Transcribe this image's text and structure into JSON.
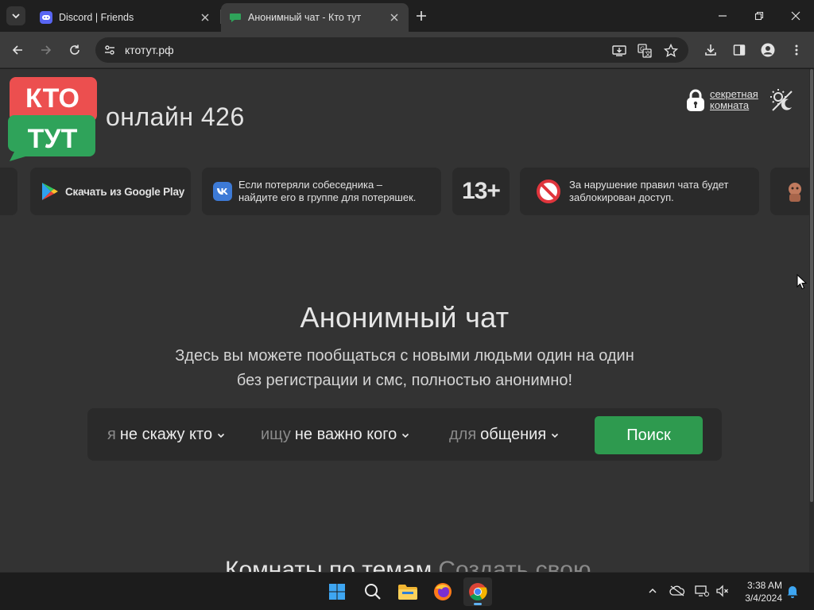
{
  "browser": {
    "tabs": [
      {
        "title": "Discord | Friends",
        "favicon": "discord-icon",
        "active": false
      },
      {
        "title": "Анонимный чат - Кто тут",
        "favicon": "chat-bubble-icon",
        "active": true
      }
    ],
    "url": "ктотут.рф"
  },
  "site": {
    "logo": {
      "line1": "КТО",
      "line2": "ТУТ"
    },
    "online": "онлайн 426",
    "secret_room": {
      "line1": "секретная",
      "line2": "комната"
    },
    "cards": {
      "gplay": "Скачать из Google Play",
      "vk_line1": "Если потеряли собеседника –",
      "vk_line2": "найдите его в группе для потеряшек.",
      "age": "13+",
      "rules_line1": "За нарушение правил чата будет",
      "rules_line2": "заблокирован доступ."
    },
    "hero": {
      "title": "Анонимный чат",
      "sub_line1": "Здесь вы можете пообщаться с новыми людьми один на один",
      "sub_line2": "без регистрации и смс, полностью анонимно!"
    },
    "search": {
      "me_prefix": "я",
      "me_value": "не скажу кто",
      "seek_prefix": "ищу",
      "seek_value": "не важно кого",
      "for_prefix": "для",
      "for_value": "общения",
      "button": "Поиск"
    },
    "rooms": {
      "title": "Комнаты по темам",
      "create": "Создать свою"
    }
  },
  "taskbar": {
    "time": "3:38 AM",
    "date": "3/4/2024"
  },
  "colors": {
    "logo_red": "#ec4f4f",
    "logo_green": "#2fa35a",
    "search_green": "#2e9a4f",
    "page_bg": "#333333",
    "card_bg": "#2a2a2a"
  }
}
